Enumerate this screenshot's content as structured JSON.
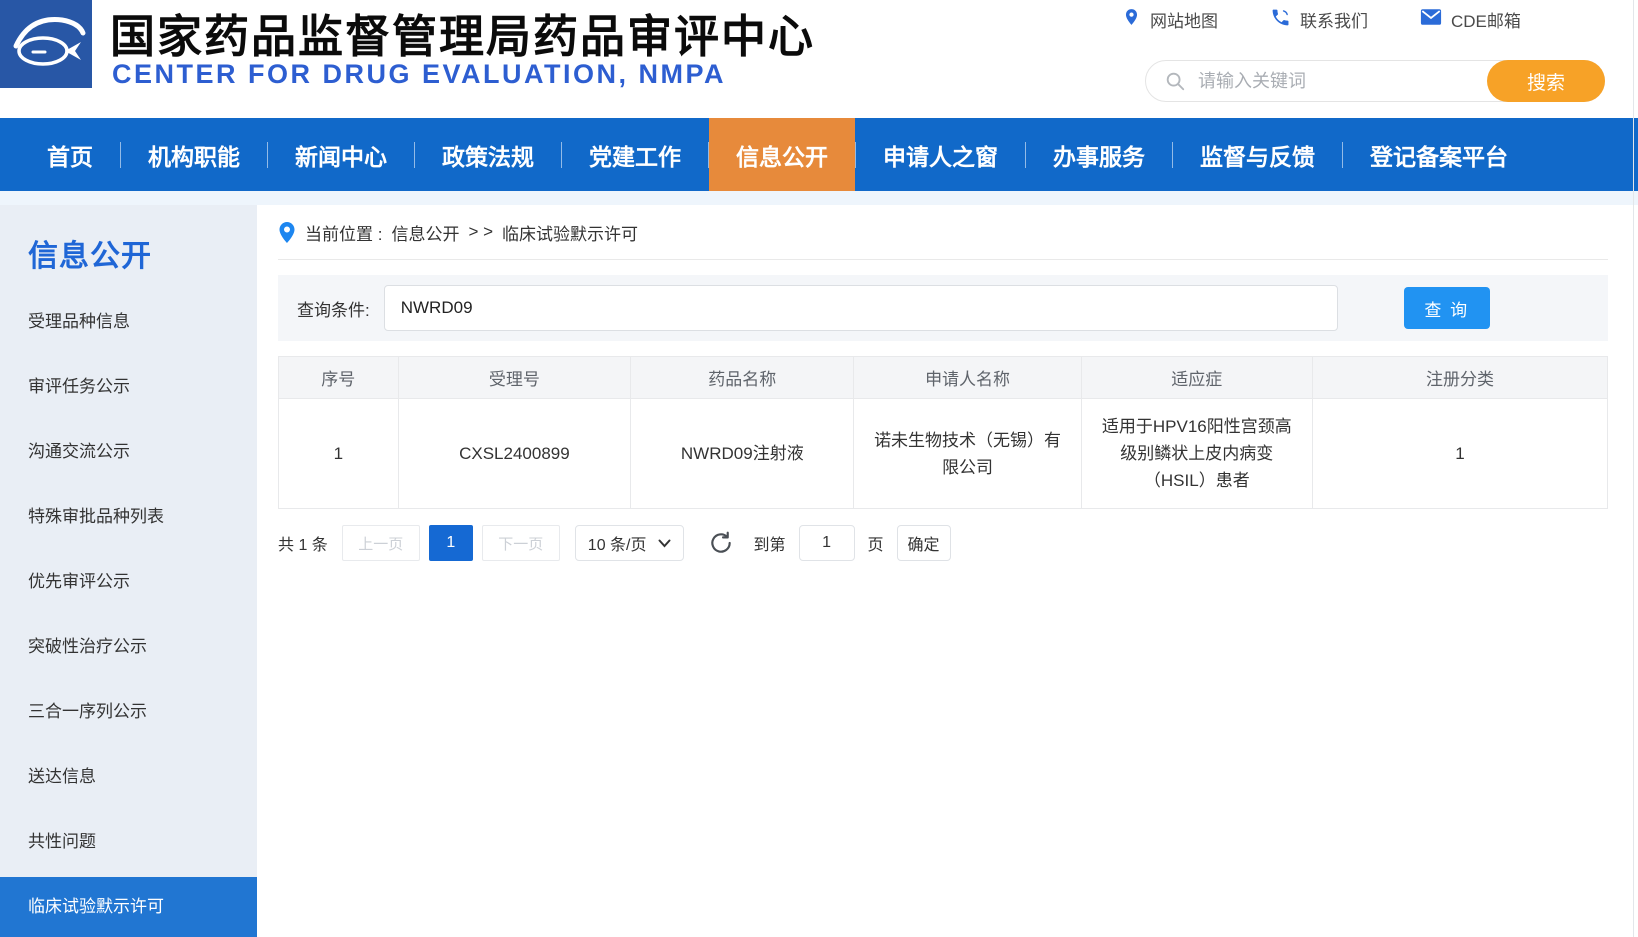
{
  "header": {
    "title_cn": "国家药品监督管理局药品审评中心",
    "title_en": "CENTER FOR DRUG EVALUATION, NMPA",
    "links": [
      {
        "label": "网站地图",
        "icon": "map-pin-icon"
      },
      {
        "label": "联系我们",
        "icon": "phone-icon"
      },
      {
        "label": "CDE邮箱",
        "icon": "mail-icon"
      }
    ],
    "search": {
      "placeholder": "请输入关键词",
      "button": "搜索",
      "icon": "search-icon"
    }
  },
  "nav": {
    "items": [
      "首页",
      "机构职能",
      "新闻中心",
      "政策法规",
      "党建工作",
      "信息公开",
      "申请人之窗",
      "办事服务",
      "监督与反馈",
      "登记备案平台"
    ],
    "active": "信息公开"
  },
  "sidebar": {
    "title": "信息公开",
    "items": [
      "受理品种信息",
      "审评任务公示",
      "沟通交流公示",
      "特殊审批品种列表",
      "优先审评公示",
      "突破性治疗公示",
      "三合一序列公示",
      "送达信息",
      "共性问题",
      "临床试验默示许可"
    ],
    "active": "临床试验默示许可"
  },
  "breadcrumb": {
    "prefix": "当前位置 :",
    "section": "信息公开",
    "separator": "> >",
    "current": "临床试验默示许可",
    "icon": "location-pin-icon"
  },
  "query": {
    "label": "查询条件:",
    "value": "NWRD09",
    "button": "查 询"
  },
  "table": {
    "headers": [
      "序号",
      "受理号",
      "药品名称",
      "申请人名称",
      "适应症",
      "注册分类"
    ],
    "rows": [
      [
        "1",
        "CXSL2400899",
        "NWRD09注射液",
        "诺未生物技术（无锡）有限公司",
        "适用于HPV16阳性宫颈高级别鳞状上皮内病变（HSIL）患者",
        "1"
      ]
    ]
  },
  "pagination": {
    "total": "共 1 条",
    "prev": "上一页",
    "current_page": "1",
    "next": "下一页",
    "page_size": "10 条/页",
    "refresh_icon": "refresh-icon",
    "goto_prefix": "到第",
    "goto_value": "1",
    "goto_suffix": "页",
    "confirm": "确定"
  },
  "colors": {
    "nav_blue": "#1169c9",
    "nav_active_orange": "#e78a3b",
    "search_orange": "#f7a227",
    "title_en_blue": "#2d5ed1",
    "link_blue": "#2b6bd8",
    "sidebar_bg": "#e9eef5",
    "sidebar_title": "#1f66d6",
    "sidebar_active": "#2176d2",
    "band": "#eef5fc",
    "panel_bg": "#f4f6f9",
    "query_button": "#2193f2",
    "page_active": "#1569d3",
    "logo_blue": "#2857a6",
    "breadcrumb_pin": "#1d86f0"
  }
}
